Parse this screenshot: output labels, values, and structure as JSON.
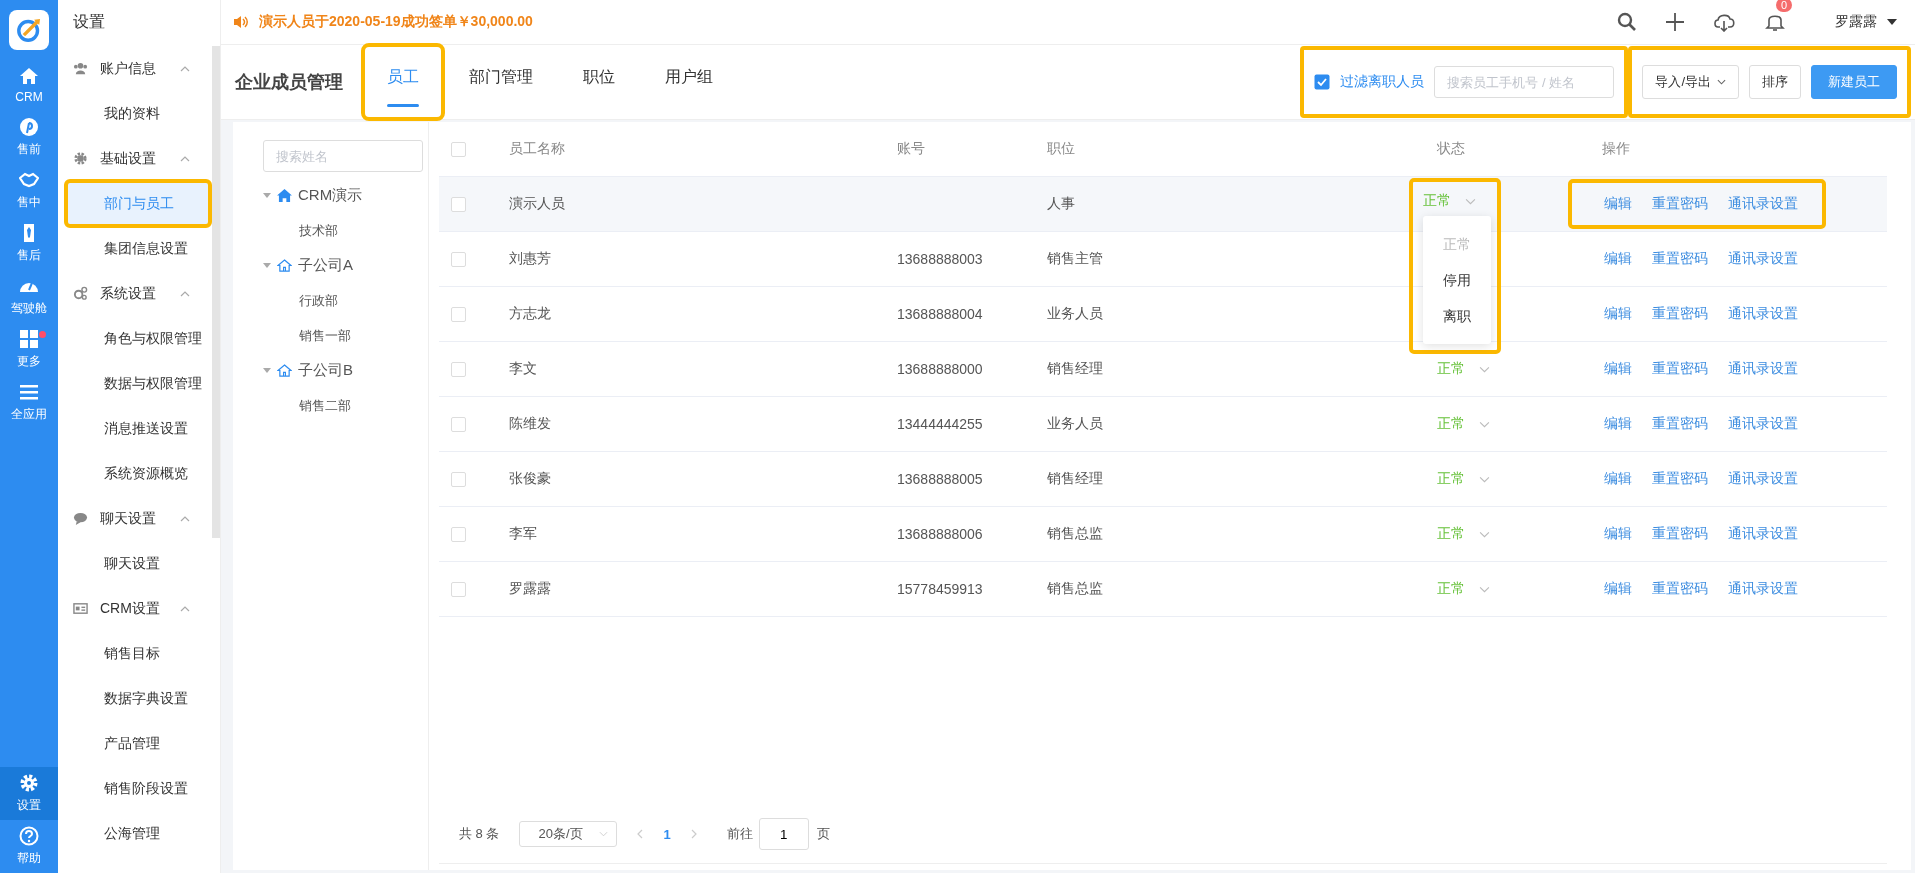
{
  "rail": {
    "items": [
      {
        "label": "CRM",
        "selected": false,
        "dot": false
      },
      {
        "label": "售前",
        "selected": false,
        "dot": false
      },
      {
        "label": "售中",
        "selected": false,
        "dot": false
      },
      {
        "label": "售后",
        "selected": false,
        "dot": false
      },
      {
        "label": "驾驶舱",
        "selected": false,
        "dot": false
      },
      {
        "label": "更多",
        "selected": false,
        "dot": true
      },
      {
        "label": "全应用",
        "selected": false,
        "dot": false
      }
    ],
    "bottom": [
      {
        "label": "设置",
        "selected": true
      },
      {
        "label": "帮助",
        "selected": false
      }
    ]
  },
  "sidebar": {
    "title": "设置",
    "groups": [
      {
        "label": "账户信息",
        "expanded": true,
        "items": [
          {
            "label": "我的资料",
            "selected": false,
            "highlighted": false
          }
        ]
      },
      {
        "label": "基础设置",
        "expanded": true,
        "items": [
          {
            "label": "部门与员工",
            "selected": true,
            "highlighted": true
          },
          {
            "label": "集团信息设置",
            "selected": false,
            "highlighted": false
          }
        ]
      },
      {
        "label": "系统设置",
        "expanded": true,
        "items": [
          {
            "label": "角色与权限管理",
            "selected": false,
            "highlighted": false
          },
          {
            "label": "数据与权限管理",
            "selected": false,
            "highlighted": false
          },
          {
            "label": "消息推送设置",
            "selected": false,
            "highlighted": false
          },
          {
            "label": "系统资源概览",
            "selected": false,
            "highlighted": false
          }
        ]
      },
      {
        "label": "聊天设置",
        "expanded": true,
        "items": [
          {
            "label": "聊天设置",
            "selected": false,
            "highlighted": false
          }
        ]
      },
      {
        "label": "CRM设置",
        "expanded": true,
        "items": [
          {
            "label": "销售目标",
            "selected": false,
            "highlighted": false
          },
          {
            "label": "数据字典设置",
            "selected": false,
            "highlighted": false
          },
          {
            "label": "产品管理",
            "selected": false,
            "highlighted": false
          },
          {
            "label": "销售阶段设置",
            "selected": false,
            "highlighted": false
          },
          {
            "label": "公海管理",
            "selected": false,
            "highlighted": false
          }
        ]
      }
    ]
  },
  "topbar": {
    "notice": "演示人员于2020-05-19成功签单￥30,000.00",
    "notifications": "0",
    "user": "罗露露"
  },
  "header": {
    "title": "企业成员管理",
    "tabs": [
      {
        "label": "员工",
        "selected": true,
        "highlighted": true
      },
      {
        "label": "部门管理",
        "selected": false,
        "highlighted": false
      },
      {
        "label": "职位",
        "selected": false,
        "highlighted": false
      },
      {
        "label": "用户组",
        "selected": false,
        "highlighted": false
      }
    ],
    "filter": {
      "label": "过滤离职人员",
      "checked": true,
      "highlighted": true,
      "search_placeholder": "搜索员工手机号 / 姓名"
    },
    "actions": {
      "highlighted": true,
      "buttons": [
        {
          "label": "导入/导出",
          "kind": "dropdown"
        },
        {
          "label": "排序",
          "kind": "default"
        },
        {
          "label": "新建员工",
          "kind": "primary"
        }
      ]
    }
  },
  "tree": {
    "search_placeholder": "搜索姓名",
    "nodes": [
      {
        "label": "CRM演示",
        "kind": "root",
        "expanded": true,
        "children": [
          {
            "label": "技术部",
            "kind": "dept"
          },
          {
            "label": "子公司A",
            "kind": "company",
            "expanded": true,
            "children": [
              {
                "label": "行政部",
                "kind": "dept"
              },
              {
                "label": "销售一部",
                "kind": "dept"
              }
            ]
          },
          {
            "label": "子公司B",
            "kind": "company",
            "expanded": true,
            "children": [
              {
                "label": "销售二部",
                "kind": "dept"
              }
            ]
          }
        ]
      }
    ]
  },
  "table": {
    "all_checked": false,
    "columns": [
      "员工名称",
      "账号",
      "职位",
      "状态",
      "操作"
    ],
    "rows": [
      {
        "name": "演示人员",
        "account": "",
        "position": "人事",
        "status": "正常",
        "checked": false,
        "highlighted": true,
        "actions": [
          "编辑",
          "重置密码",
          "通讯录设置"
        ],
        "status_menu": [
          {
            "label": "正常",
            "disabled": true
          },
          {
            "label": "停用",
            "disabled": false
          },
          {
            "label": "离职",
            "disabled": false
          }
        ]
      },
      {
        "name": "刘惠芳",
        "account": "13688888003",
        "position": "销售主管",
        "checked": false,
        "highlighted": false,
        "actions": [
          "编辑",
          "重置密码",
          "通讯录设置"
        ]
      },
      {
        "name": "方志龙",
        "account": "13688888004",
        "position": "业务人员",
        "checked": false,
        "highlighted": false,
        "actions": [
          "编辑",
          "重置密码",
          "通讯录设置"
        ]
      },
      {
        "name": "李文",
        "account": "13688888000",
        "position": "销售经理",
        "status": "正常",
        "checked": false,
        "highlighted": false,
        "actions": [
          "编辑",
          "重置密码",
          "通讯录设置"
        ]
      },
      {
        "name": "陈维发",
        "account": "13444444255",
        "position": "业务人员",
        "status": "正常",
        "checked": false,
        "highlighted": false,
        "actions": [
          "编辑",
          "重置密码",
          "通讯录设置"
        ]
      },
      {
        "name": "张俊豪",
        "account": "13688888005",
        "position": "销售经理",
        "status": "正常",
        "checked": false,
        "highlighted": false,
        "actions": [
          "编辑",
          "重置密码",
          "通讯录设置"
        ]
      },
      {
        "name": "李军",
        "account": "13688888006",
        "position": "销售总监",
        "status": "正常",
        "checked": false,
        "highlighted": false,
        "actions": [
          "编辑",
          "重置密码",
          "通讯录设置"
        ]
      },
      {
        "name": "罗露露",
        "account": "15778459913",
        "position": "销售总监",
        "status": "正常",
        "checked": false,
        "highlighted": false,
        "actions": [
          "编辑",
          "重置密码",
          "通讯录设置"
        ]
      }
    ]
  },
  "pagination": {
    "total": "共 8 条",
    "page_size": "20条/页",
    "pages": [
      {
        "label": "1",
        "selected": true
      }
    ],
    "goto_label": "前往",
    "goto_value": "1",
    "page_suffix": "页"
  }
}
